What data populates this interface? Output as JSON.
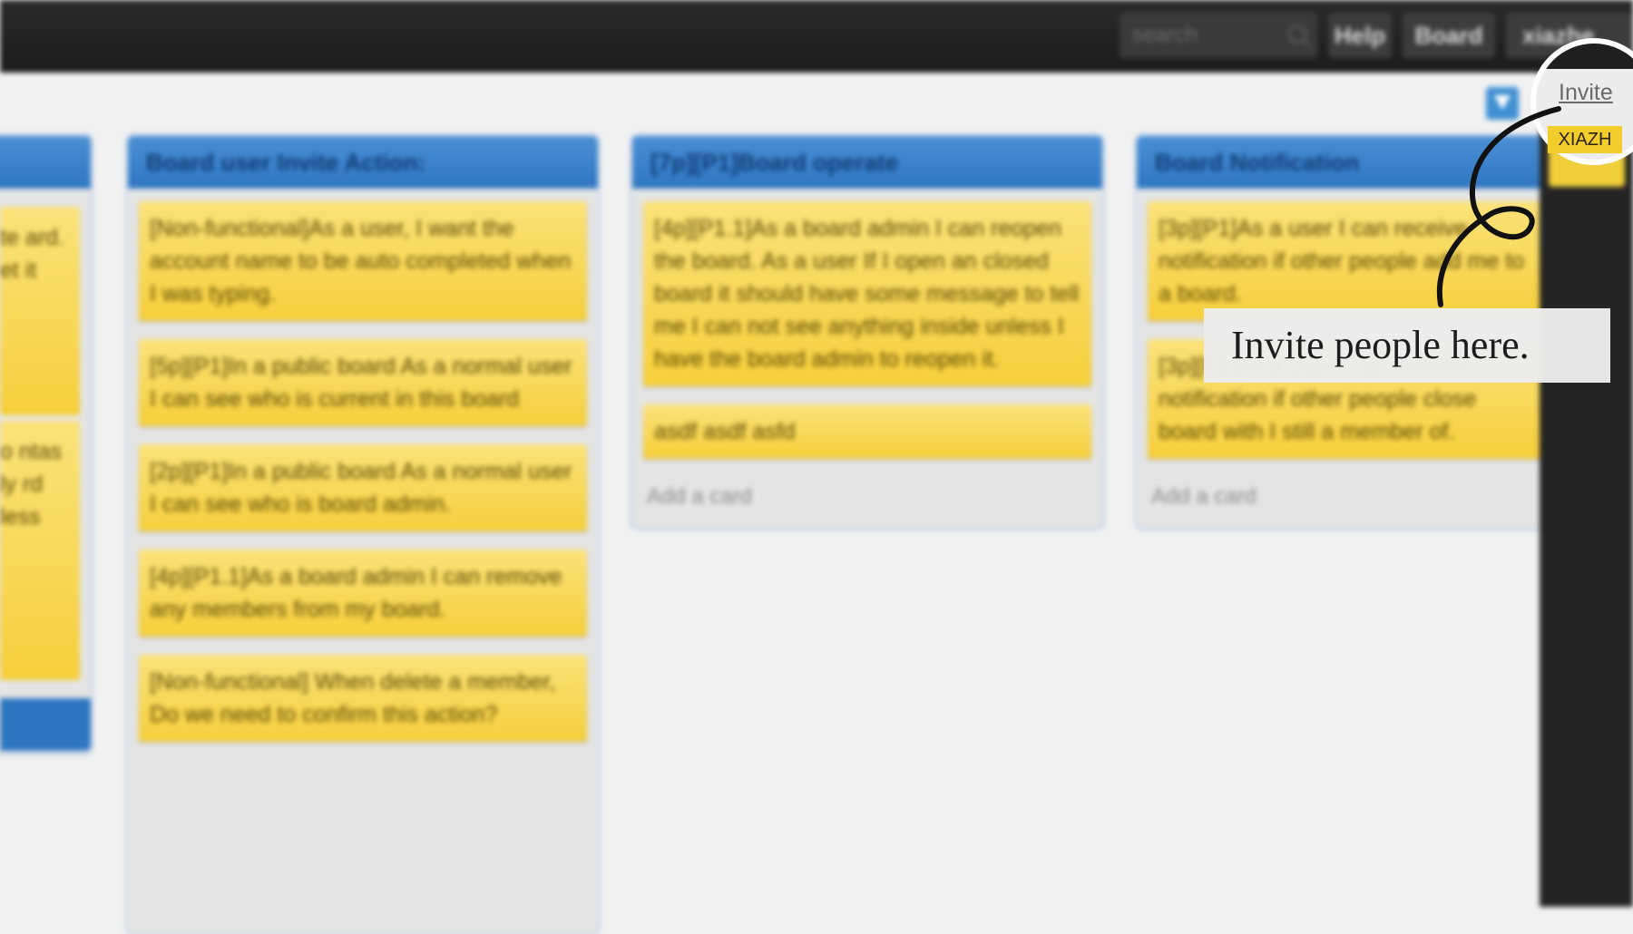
{
  "topbar": {
    "search_placeholder": "search",
    "help_label": "Help",
    "board_label": "Board",
    "user_label": "xiazhe"
  },
  "lists": [
    {
      "title": "",
      "cards": [
        "te ard. et it",
        "o ntas ly rd less"
      ]
    },
    {
      "title": "Board user Invite Action:",
      "cards": [
        "[Non-functional]As a user, I want the account name to be auto completed when I was typing.",
        "[5p][P1]In a public board As a normal user I can see who is current in this board",
        "[2p][P1]In a public board As a normal user I can see who is board admin.",
        "[4p][P1.1]As a board admin I can remove any members from my board.",
        "[Non-functional] When delete a member, Do we need to confirm this action?"
      ]
    },
    {
      "title": "[7p][P1]Board operate",
      "cards": [
        "[4p][P1.1]As a board admin I can reopen the board. As a user If I open an closed board it should have some message to tell me I can not see anything inside unless I have the board admin to reopen it.",
        "asdf asdf asfd"
      ],
      "add_label": "Add a card"
    },
    {
      "title": "Board Notification",
      "cards": [
        "[3p][P1]As a user I can receive notification if other people add me to a board.",
        "[3p][P1]As a user I can receive notification if other people close board with I still a member of."
      ],
      "add_label": "Add a card"
    }
  ],
  "sidebar": {
    "invite_label": "Invite",
    "member_initials": "XIAZH"
  },
  "tooltip": {
    "text": "Invite people here."
  },
  "colors": {
    "topbar": "#1f1f1f",
    "list_header": "#3a82cb",
    "card": "#f6d34a",
    "callout_bg": "#ececec"
  }
}
